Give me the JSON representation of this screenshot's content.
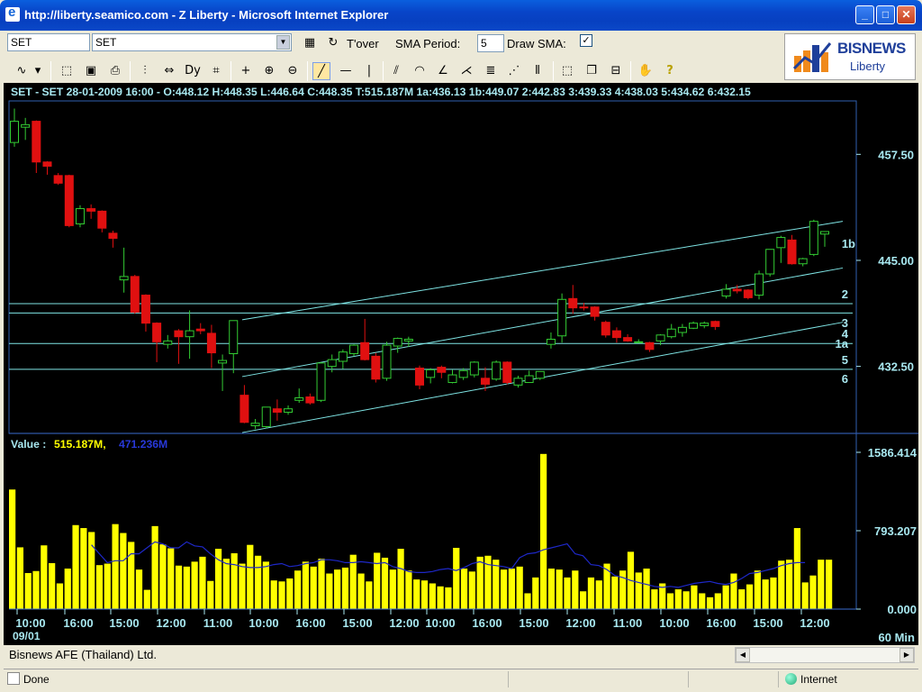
{
  "window": {
    "title": "http://liberty.seamico.com - Z Liberty - Microsoft Internet Explorer",
    "min_label": "_",
    "max_label": "□",
    "close_label": "✕"
  },
  "toolbar": {
    "symbol_input": "SET",
    "symbol_select": "SET",
    "tover_label": "T'over",
    "sma_period_label": "SMA Period:",
    "sma_period_value": "5",
    "draw_sma_label": "Draw SMA:",
    "draw_sma_checked": "✓"
  },
  "logo": {
    "word": "BISNEWS",
    "sub": "Liberty"
  },
  "chart": {
    "info_line": "SET - SET 28-01-2009 16:00 - O:448.12 H:448.35 L:446.64 C:448.35 T:515.187M 1a:436.13 1b:449.07 2:442.83 3:439.33 4:438.03 5:434.62 6:432.15",
    "price_ticks": [
      "457.50",
      "445.00",
      "432.50"
    ],
    "line_labels": [
      "1b",
      "2",
      "3",
      "4",
      "1a",
      "5",
      "6"
    ],
    "volume_label": "Value : ",
    "volume_value1": "515.187M,",
    "volume_value2": "471.236M",
    "volume_ticks": [
      "1586.414",
      "793.207",
      "0.000"
    ],
    "time_ticks": [
      "10:00",
      "16:00",
      "15:00",
      "12:00",
      "11:00",
      "10:00",
      "16:00",
      "15:00",
      "12:00",
      "10:00",
      "16:00",
      "15:00",
      "12:00",
      "11:00",
      "10:00",
      "16:00",
      "15:00",
      "12:00"
    ],
    "date_label": "09/01",
    "interval_label": "60 Min",
    "colors": {
      "up": "#33CC33",
      "down": "#E01010",
      "volume": "#FFFF00",
      "sma": "#1E28C8",
      "lines": "#7FE5E5",
      "text": "#A8E8F0"
    }
  },
  "chart_data": {
    "type": "candlestick",
    "price_axis": {
      "min": 424.6,
      "max": 463.8,
      "ticks": [
        457.5,
        445.0,
        432.5
      ]
    },
    "candles": [
      {
        "o": 458.9,
        "h": 462.9,
        "l": 458.4,
        "c": 461.4
      },
      {
        "o": 460.7,
        "h": 461.8,
        "l": 459.2,
        "c": 461.0
      },
      {
        "o": 461.4,
        "h": 461.5,
        "l": 455.3,
        "c": 456.6
      },
      {
        "o": 456.6,
        "h": 456.7,
        "l": 455.1,
        "c": 456.1
      },
      {
        "o": 455.0,
        "h": 455.3,
        "l": 453.9,
        "c": 454.1
      },
      {
        "o": 455.0,
        "h": 455.1,
        "l": 448.9,
        "c": 449.1
      },
      {
        "o": 449.3,
        "h": 451.5,
        "l": 448.9,
        "c": 451.1
      },
      {
        "o": 451.1,
        "h": 451.6,
        "l": 449.9,
        "c": 450.8
      },
      {
        "o": 450.8,
        "h": 450.9,
        "l": 448.3,
        "c": 448.8
      },
      {
        "o": 448.2,
        "h": 448.5,
        "l": 446.5,
        "c": 447.6
      },
      {
        "o": 442.7,
        "h": 446.5,
        "l": 441.2,
        "c": 443.1
      },
      {
        "o": 443.1,
        "h": 443.3,
        "l": 438.7,
        "c": 438.9
      },
      {
        "o": 440.9,
        "h": 441.0,
        "l": 436.6,
        "c": 437.6
      },
      {
        "o": 437.6,
        "h": 437.7,
        "l": 433.0,
        "c": 435.4
      },
      {
        "o": 435.1,
        "h": 436.2,
        "l": 434.6,
        "c": 435.5
      },
      {
        "o": 436.7,
        "h": 436.9,
        "l": 432.8,
        "c": 436.0
      },
      {
        "o": 436.0,
        "h": 439.1,
        "l": 433.4,
        "c": 436.7
      },
      {
        "o": 436.9,
        "h": 437.6,
        "l": 436.3,
        "c": 436.7
      },
      {
        "o": 436.4,
        "h": 437.4,
        "l": 432.3,
        "c": 434.1
      },
      {
        "o": 432.9,
        "h": 433.9,
        "l": 429.6,
        "c": 433.2
      },
      {
        "o": 434.0,
        "h": 437.9,
        "l": 431.7,
        "c": 437.9
      },
      {
        "o": 429.1,
        "h": 430.3,
        "l": 425.8,
        "c": 425.9
      },
      {
        "o": 425.5,
        "h": 426.3,
        "l": 425.1,
        "c": 425.8
      },
      {
        "o": 425.4,
        "h": 427.7,
        "l": 425.2,
        "c": 427.7
      },
      {
        "o": 427.5,
        "h": 428.6,
        "l": 426.1,
        "c": 427.1
      },
      {
        "o": 427.1,
        "h": 427.9,
        "l": 426.8,
        "c": 427.5
      },
      {
        "o": 428.5,
        "h": 429.9,
        "l": 428.2,
        "c": 428.8
      },
      {
        "o": 428.9,
        "h": 429.3,
        "l": 428.0,
        "c": 428.2
      },
      {
        "o": 428.5,
        "h": 433.0,
        "l": 428.3,
        "c": 432.9
      },
      {
        "o": 432.5,
        "h": 433.9,
        "l": 431.8,
        "c": 433.3
      },
      {
        "o": 433.1,
        "h": 434.5,
        "l": 432.2,
        "c": 434.2
      },
      {
        "o": 434.0,
        "h": 435.1,
        "l": 433.7,
        "c": 435.0
      },
      {
        "o": 435.3,
        "h": 438.1,
        "l": 433.2,
        "c": 433.3
      },
      {
        "o": 433.7,
        "h": 434.1,
        "l": 430.6,
        "c": 431.0
      },
      {
        "o": 431.1,
        "h": 435.4,
        "l": 430.8,
        "c": 435.0
      },
      {
        "o": 434.9,
        "h": 435.9,
        "l": 434.1,
        "c": 435.8
      },
      {
        "o": 435.5,
        "h": 436.0,
        "l": 434.8,
        "c": 435.7
      },
      {
        "o": 432.3,
        "h": 432.6,
        "l": 429.8,
        "c": 430.3
      },
      {
        "o": 431.2,
        "h": 432.3,
        "l": 430.5,
        "c": 432.1
      },
      {
        "o": 432.4,
        "h": 432.6,
        "l": 431.1,
        "c": 431.8
      },
      {
        "o": 430.6,
        "h": 432.1,
        "l": 430.5,
        "c": 431.5
      },
      {
        "o": 431.2,
        "h": 432.3,
        "l": 430.9,
        "c": 432.0
      },
      {
        "o": 431.5,
        "h": 433.1,
        "l": 431.2,
        "c": 433.0
      },
      {
        "o": 431.1,
        "h": 432.4,
        "l": 429.6,
        "c": 430.4
      },
      {
        "o": 431.0,
        "h": 433.2,
        "l": 430.8,
        "c": 433.0
      },
      {
        "o": 433.0,
        "h": 433.1,
        "l": 430.4,
        "c": 430.6
      },
      {
        "o": 430.3,
        "h": 431.4,
        "l": 430.0,
        "c": 431.1
      },
      {
        "o": 430.6,
        "h": 432.0,
        "l": 430.6,
        "c": 431.4
      },
      {
        "o": 431.1,
        "h": 431.8,
        "l": 430.9,
        "c": 431.9
      },
      {
        "o": 435.1,
        "h": 436.5,
        "l": 434.6,
        "c": 435.7
      },
      {
        "o": 436.1,
        "h": 441.1,
        "l": 435.3,
        "c": 440.4
      },
      {
        "o": 440.5,
        "h": 442.1,
        "l": 438.7,
        "c": 439.4
      },
      {
        "o": 439.5,
        "h": 440.0,
        "l": 439.1,
        "c": 439.4
      },
      {
        "o": 439.5,
        "h": 439.6,
        "l": 437.9,
        "c": 438.4
      },
      {
        "o": 437.7,
        "h": 437.9,
        "l": 435.9,
        "c": 436.2
      },
      {
        "o": 436.7,
        "h": 437.1,
        "l": 435.3,
        "c": 435.9
      },
      {
        "o": 435.9,
        "h": 436.3,
        "l": 435.4,
        "c": 435.5
      },
      {
        "o": 435.4,
        "h": 435.7,
        "l": 435.3,
        "c": 435.4
      },
      {
        "o": 435.3,
        "h": 435.4,
        "l": 434.2,
        "c": 434.5
      },
      {
        "o": 435.5,
        "h": 436.3,
        "l": 435.0,
        "c": 436.2
      },
      {
        "o": 436.0,
        "h": 437.5,
        "l": 435.8,
        "c": 436.9
      },
      {
        "o": 436.5,
        "h": 437.5,
        "l": 436.0,
        "c": 437.1
      },
      {
        "o": 437.0,
        "h": 437.8,
        "l": 436.9,
        "c": 437.6
      },
      {
        "o": 437.3,
        "h": 437.8,
        "l": 437.0,
        "c": 437.6
      },
      {
        "o": 437.8,
        "h": 437.9,
        "l": 436.8,
        "c": 437.2
      },
      {
        "o": 440.8,
        "h": 442.2,
        "l": 440.5,
        "c": 441.6
      },
      {
        "o": 441.6,
        "h": 442.1,
        "l": 441.1,
        "c": 441.4
      },
      {
        "o": 441.5,
        "h": 441.6,
        "l": 440.4,
        "c": 440.6
      },
      {
        "o": 440.9,
        "h": 443.8,
        "l": 440.4,
        "c": 443.4
      },
      {
        "o": 443.4,
        "h": 446.3,
        "l": 443.1,
        "c": 446.3
      },
      {
        "o": 446.5,
        "h": 447.9,
        "l": 444.7,
        "c": 447.7
      },
      {
        "o": 447.4,
        "h": 448.0,
        "l": 444.5,
        "c": 444.6
      },
      {
        "o": 444.6,
        "h": 445.3,
        "l": 444.3,
        "c": 445.2
      },
      {
        "o": 445.7,
        "h": 449.8,
        "l": 445.5,
        "c": 449.6
      },
      {
        "o": 448.1,
        "h": 448.4,
        "l": 446.6,
        "c": 448.4
      }
    ],
    "volume": [
      1210,
      625,
      365,
      385,
      645,
      465,
      260,
      410,
      850,
      820,
      780,
      445,
      460,
      860,
      770,
      680,
      400,
      195,
      840,
      655,
      615,
      440,
      430,
      480,
      530,
      285,
      610,
      510,
      565,
      460,
      650,
      540,
      480,
      290,
      280,
      310,
      390,
      480,
      430,
      510,
      360,
      400,
      420,
      550,
      360,
      280,
      570,
      520,
      400,
      610,
      390,
      300,
      290,
      260,
      230,
      220,
      620,
      410,
      380,
      530,
      540,
      500,
      400,
      410,
      430,
      160,
      320,
      1570,
      410,
      400,
      320,
      390,
      180,
      320,
      290,
      460,
      330,
      390,
      580,
      370,
      410,
      200,
      260,
      160,
      200,
      180,
      240,
      160,
      120,
      160,
      240,
      360,
      200,
      250,
      390,
      300,
      320,
      490,
      500,
      820,
      270,
      340,
      500,
      500
    ],
    "volume_axis": {
      "min": 0.0,
      "max": 1586.414,
      "ticks": [
        1586.414,
        793.207,
        0.0
      ]
    },
    "sma_start": 10,
    "sma": [
      650,
      560,
      470,
      490,
      490,
      560,
      560,
      620,
      680,
      660,
      620,
      620,
      680,
      640,
      630,
      560,
      500,
      460,
      450,
      430,
      420,
      420,
      430,
      450,
      460,
      430,
      440,
      460,
      470,
      500,
      500,
      490,
      470,
      470,
      480,
      470,
      460,
      470,
      430,
      410,
      380,
      370,
      370,
      380,
      400,
      410,
      390,
      420,
      460,
      480,
      450,
      440,
      430,
      410,
      520,
      560,
      570,
      600,
      620,
      640,
      660,
      560,
      540,
      450,
      440,
      400,
      340,
      320,
      290,
      270,
      250,
      230,
      220,
      230,
      220,
      240,
      260,
      270,
      280,
      260,
      250,
      270,
      310,
      360,
      370,
      390,
      410,
      440,
      460,
      470,
      470
    ],
    "horizontal_lines": [
      439.9,
      438.8,
      435.2,
      432.15
    ],
    "trend_lines": [
      {
        "from": [
          0,
          438.0
        ],
        "to": [
          1,
          449.6
        ]
      },
      {
        "from": [
          0,
          431.3
        ],
        "to": [
          1,
          444.1
        ]
      },
      {
        "from": [
          0,
          424.7
        ],
        "to": [
          1,
          437.7
        ]
      }
    ]
  }
}
